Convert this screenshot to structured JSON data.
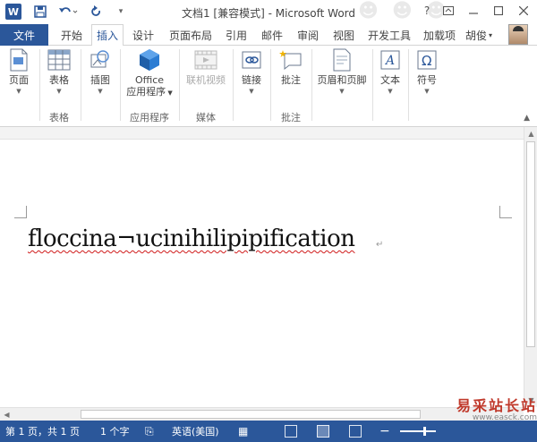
{
  "title_bar": {
    "logo_letter": "W",
    "document_title": "文档1 [兼容模式] - Microsoft Word",
    "quick_access": [
      "save",
      "undo",
      "redo",
      "customize"
    ],
    "controls": [
      "?",
      "restore-ribbon",
      "minimize",
      "maximize",
      "close"
    ]
  },
  "tabs": {
    "file": "文件",
    "items": [
      "开始",
      "插入",
      "设计",
      "页面布局",
      "引用",
      "邮件",
      "审阅",
      "视图",
      "开发工具",
      "加载项"
    ],
    "active": "插入",
    "user": "胡俊"
  },
  "ribbon": {
    "buttons": [
      {
        "label": "页面",
        "icon": "page-icon",
        "dropdown": true
      },
      {
        "label": "表格",
        "icon": "table-icon",
        "dropdown": true
      },
      {
        "label": "插图",
        "icon": "illustration-icon",
        "dropdown": true
      },
      {
        "label": "Office",
        "label2": "应用程序",
        "icon": "office-apps-icon",
        "dropdown": true
      },
      {
        "label": "联机视频",
        "icon": "online-video-icon",
        "disabled": true
      },
      {
        "label": "链接",
        "icon": "link-icon",
        "dropdown": true
      },
      {
        "label": "批注",
        "icon": "comment-icon"
      },
      {
        "label": "页眉和页脚",
        "icon": "header-footer-icon",
        "dropdown": true
      },
      {
        "label": "文本",
        "icon": "text-icon",
        "dropdown": true
      },
      {
        "label": "符号",
        "icon": "symbol-icon",
        "dropdown": true
      }
    ],
    "groups": [
      "表格",
      "应用程序",
      "媒体",
      "批注"
    ]
  },
  "document": {
    "text": "floccina¬ucinihilipipification",
    "paragraph_mark": "↵"
  },
  "watermark": {
    "chinese": "易采站长站",
    "url": "www.easck.com"
  },
  "status_bar": {
    "page": "第 1 页，共 1 页",
    "words": "1 个字",
    "language": "英语(美国)"
  },
  "colors": {
    "accent": "#2b579a",
    "spell_error": "#d01c1c",
    "watermark_red": "#c0392b"
  }
}
